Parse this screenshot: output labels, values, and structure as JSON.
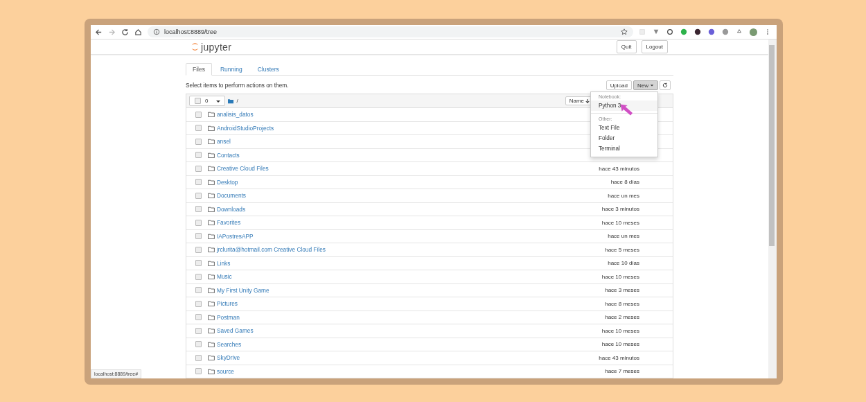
{
  "browser": {
    "url": "localhost:8889/tree",
    "status_url": "localhost:8889/tree#"
  },
  "header": {
    "logo_text": "jupyter",
    "buttons": [
      "Quit",
      "Logout"
    ]
  },
  "tabs": [
    {
      "label": "Files",
      "selected": true
    },
    {
      "label": "Running",
      "selected": false
    },
    {
      "label": "Clusters",
      "selected": false
    }
  ],
  "toolbar": {
    "hint": "Select items to perform actions on them.",
    "upload": "Upload",
    "new": "New",
    "new_open": true
  },
  "list_header": {
    "all_checked": false,
    "selected_count": "0",
    "path": "/",
    "sort_label": "Name"
  },
  "new_menu": [
    {
      "heading": "Notebook:",
      "items": [
        {
          "label": "Python 3",
          "selected": true
        }
      ]
    },
    {
      "heading": "Other:",
      "items": [
        {
          "label": "Text File",
          "selected": false
        },
        {
          "label": "Folder",
          "selected": false
        },
        {
          "label": "Terminal",
          "selected": false
        }
      ]
    }
  ],
  "rows": [
    {
      "name": "analisis_datos",
      "checked": false
    },
    {
      "name": "AndroidStudioProjects",
      "checked": false
    },
    {
      "name": "ansel",
      "checked": false
    },
    {
      "name": "Contacts",
      "checked": false
    },
    {
      "name": "Creative Cloud Files",
      "modified": "hace 43 minutos",
      "checked": false
    },
    {
      "name": "Desktop",
      "modified": "hace 8 días",
      "checked": false
    },
    {
      "name": "Documents",
      "modified": "hace un mes",
      "checked": false
    },
    {
      "name": "Downloads",
      "modified": "hace 3 minutos",
      "checked": false
    },
    {
      "name": "Favorites",
      "modified": "hace 10 meses",
      "checked": false
    },
    {
      "name": "IAPostresAPP",
      "modified": "hace un mes",
      "checked": false
    },
    {
      "name": "jrclurita@hotmail.com Creative Cloud Files",
      "modified": "hace 5 meses",
      "checked": false
    },
    {
      "name": "Links",
      "modified": "hace 10 días",
      "checked": false
    },
    {
      "name": "Music",
      "modified": "hace 10 meses",
      "checked": false
    },
    {
      "name": "My First Unity Game",
      "modified": "hace 3 meses",
      "checked": false
    },
    {
      "name": "Pictures",
      "modified": "hace 8 meses",
      "checked": false
    },
    {
      "name": "Postman",
      "modified": "hace 2 meses",
      "checked": false
    },
    {
      "name": "Saved Games",
      "modified": "hace 10 meses",
      "checked": false
    },
    {
      "name": "Searches",
      "modified": "hace 10 meses",
      "checked": false
    },
    {
      "name": "SkyDrive",
      "modified": "hace 43 minutos",
      "checked": false
    },
    {
      "name": "source",
      "modified": "hace 7 meses",
      "checked": false
    }
  ]
}
